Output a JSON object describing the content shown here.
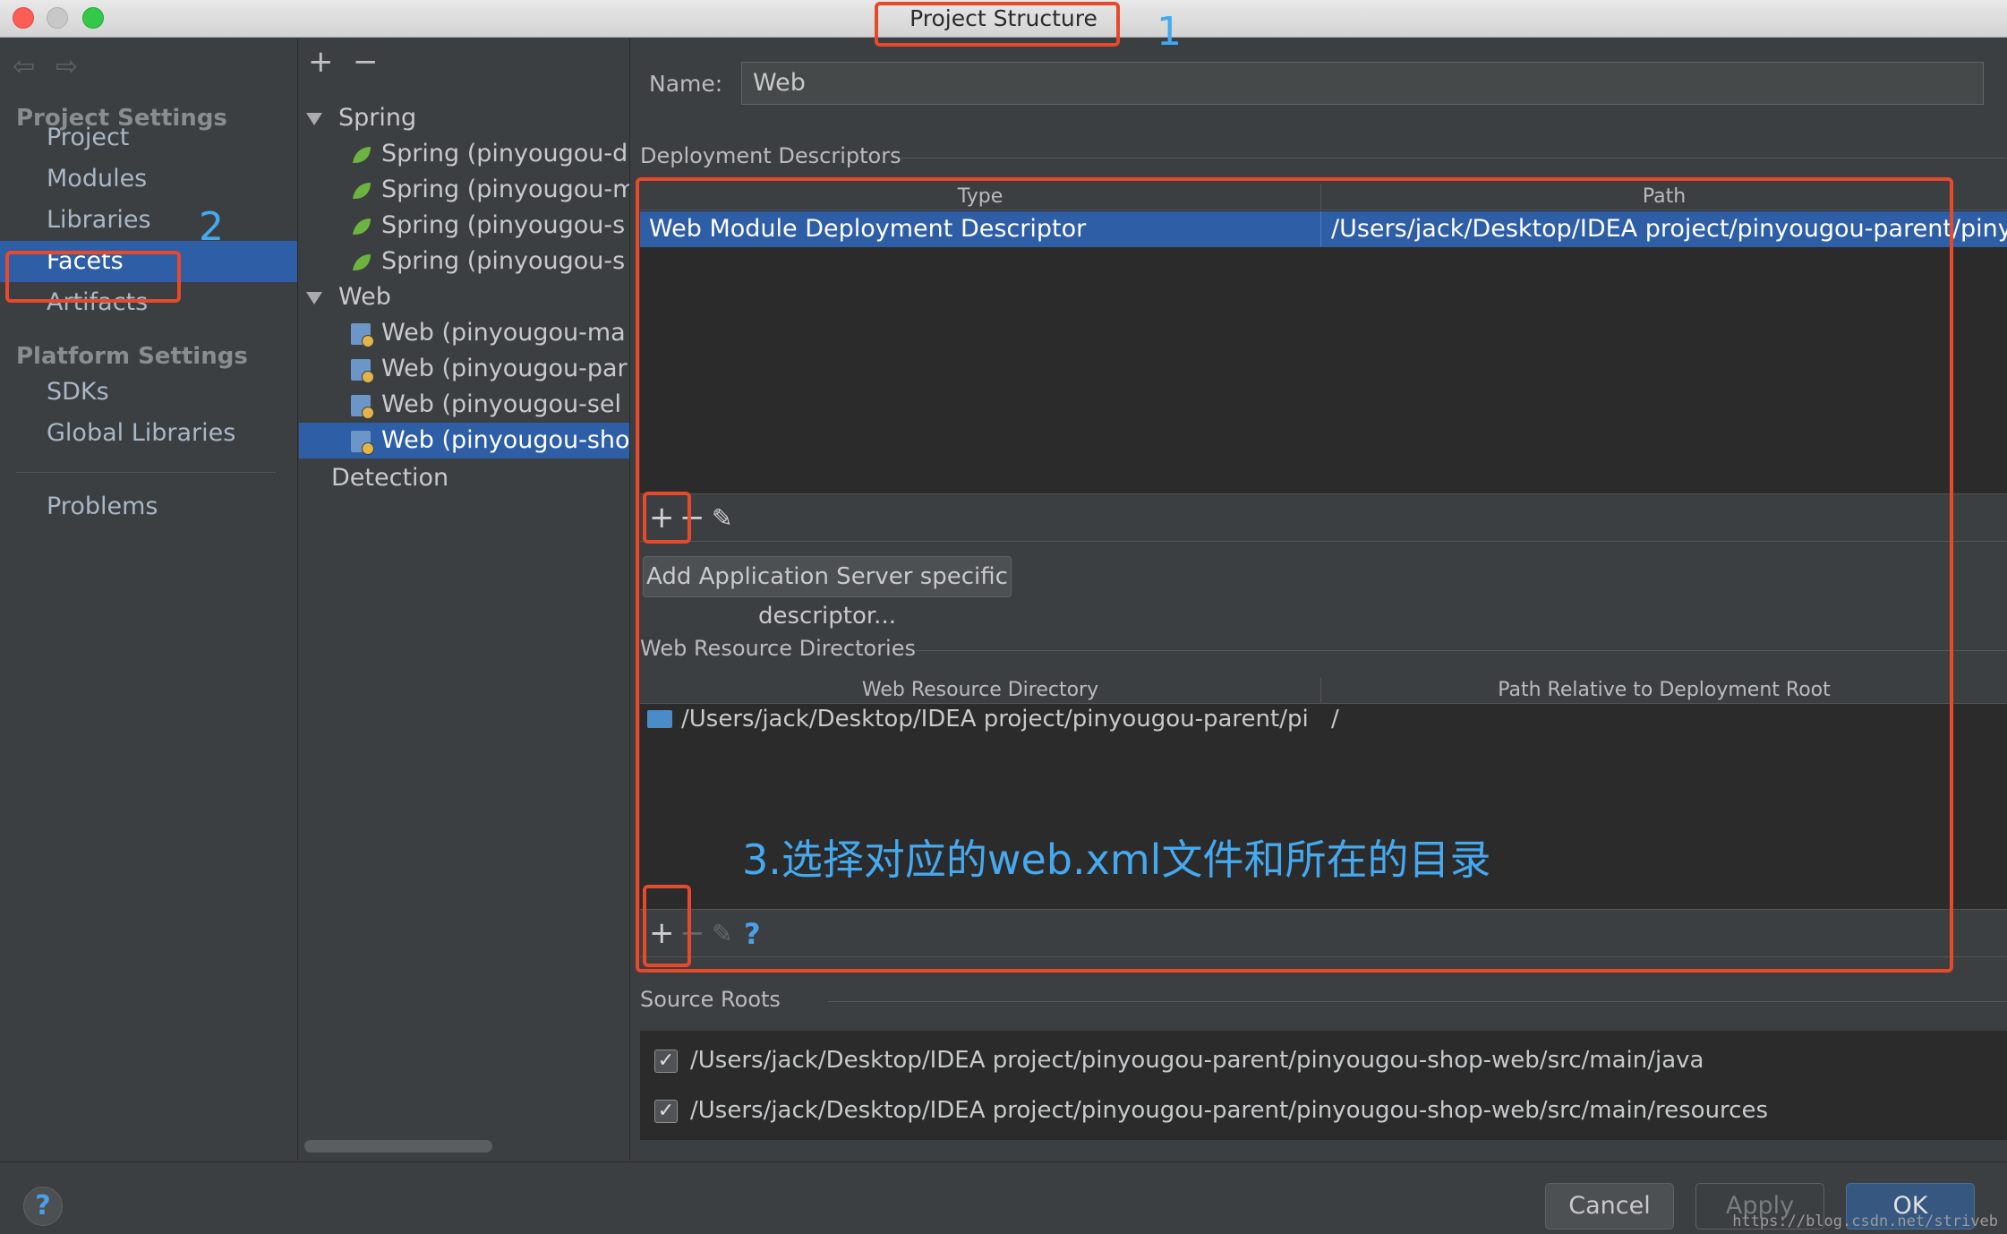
{
  "window": {
    "title": "Project Structure"
  },
  "left_nav": {
    "sections": [
      {
        "title": "Project Settings",
        "items": [
          "Project",
          "Modules",
          "Libraries",
          "Facets",
          "Artifacts"
        ]
      },
      {
        "title": "Platform Settings",
        "items": [
          "SDKs",
          "Global Libraries"
        ]
      }
    ],
    "extra": "Problems",
    "selected": "Facets"
  },
  "tree": {
    "add_label": "+",
    "remove_label": "−",
    "groups": [
      {
        "label": "Spring",
        "items": [
          "Spring (pinyougou-d",
          "Spring (pinyougou-m",
          "Spring (pinyougou-s",
          "Spring (pinyougou-s"
        ]
      },
      {
        "label": "Web",
        "items": [
          "Web (pinyougou-ma",
          "Web (pinyougou-par",
          "Web (pinyougou-sel",
          "Web (pinyougou-sho"
        ]
      }
    ],
    "detection": "Detection",
    "selected_item": "Web (pinyougou-sho"
  },
  "main": {
    "name_label": "Name:",
    "name_value": "Web",
    "deployment": {
      "section_title": "Deployment Descriptors",
      "columns": [
        "Type",
        "Path"
      ],
      "rows": [
        {
          "type": "Web Module Deployment Descriptor",
          "path": "/Users/jack/Desktop/IDEA  project/pinyougou-parent/pinyougou"
        }
      ],
      "add_server_button": "Add Application Server specific descriptor..."
    },
    "web_resources": {
      "section_title": "Web Resource Directories",
      "columns": [
        "Web Resource Directory",
        "Path Relative to Deployment Root"
      ],
      "rows": [
        {
          "directory": "/Users/jack/Desktop/IDEA  project/pinyougou-parent/pi...",
          "relative": "/"
        }
      ]
    },
    "source_roots": {
      "section_title": "Source Roots",
      "items": [
        {
          "checked": true,
          "mark": "✓",
          "path": "/Users/jack/Desktop/IDEA  project/pinyougou-parent/pinyougou-shop-web/src/main/java"
        },
        {
          "checked": true,
          "mark": "✓",
          "path": "/Users/jack/Desktop/IDEA  project/pinyougou-parent/pinyougou-shop-web/src/main/resources"
        }
      ]
    }
  },
  "toolbar": {
    "add": "+",
    "remove": "−",
    "edit": "✎",
    "help": "?"
  },
  "buttons": {
    "help": "?",
    "cancel": "Cancel",
    "apply": "Apply",
    "ok": "OK"
  },
  "annotations": {
    "num1": "1",
    "num2": "2",
    "text3": "3.选择对应的web.xml文件和所在的目录",
    "accent": "#e8492b",
    "text_color": "#45a9f0"
  },
  "watermark": "https://blog.csdn.net/striveb",
  "colors": {
    "selection": "#2e5ea6",
    "background": "#3c3f41",
    "table_bg": "#2b2b2b"
  }
}
